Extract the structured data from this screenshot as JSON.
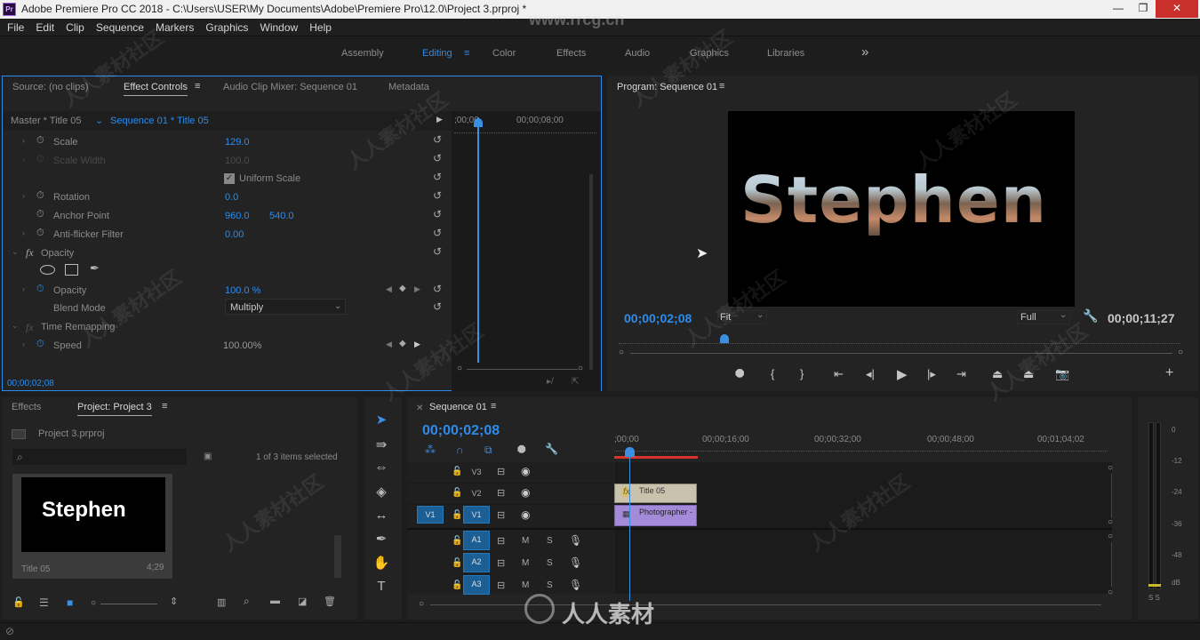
{
  "title_bar": {
    "app_icon": "Pr",
    "title": "Adobe Premiere Pro CC 2018 - C:\\Users\\USER\\My Documents\\Adobe\\Premiere Pro\\12.0\\Project 3.prproj *",
    "minimize": "—",
    "restore": "❐",
    "close": "✕"
  },
  "menu": [
    "File",
    "Edit",
    "Clip",
    "Sequence",
    "Markers",
    "Graphics",
    "Window",
    "Help"
  ],
  "workspaces": {
    "items": [
      "Assembly",
      "Editing",
      "Color",
      "Effects",
      "Audio",
      "Graphics",
      "Libraries"
    ],
    "active": "Editing",
    "more": "»"
  },
  "source_panel": {
    "tabs": [
      "Source: (no clips)",
      "Effect Controls",
      "Audio Clip Mixer: Sequence 01",
      "Metadata"
    ],
    "active_tab": "Effect Controls",
    "master": "Master * Title 05",
    "sequence": "Sequence 01 * Title 05",
    "ruler_start": ";00;00",
    "ruler_end": "00;00;08;00",
    "timecode": "00;00;02;08",
    "properties": [
      {
        "name": "Scale",
        "value": "129.0"
      },
      {
        "name": "Scale Width",
        "value": "100.0"
      },
      {
        "name": "Uniform Scale",
        "value": ""
      },
      {
        "name": "Rotation",
        "value": "0.0"
      },
      {
        "name": "Anchor Point",
        "value": "960.0",
        "value2": "540.0"
      },
      {
        "name": "Anti-flicker Filter",
        "value": "0.00"
      },
      {
        "name": "Opacity",
        "value": ""
      },
      {
        "name": "Opacity",
        "value": "100.0 %"
      },
      {
        "name": "Blend Mode",
        "value": "Multiply"
      },
      {
        "name": "Time Remapping",
        "value": ""
      },
      {
        "name": "Speed",
        "value": "100.00%"
      }
    ],
    "fx": "fx"
  },
  "program": {
    "title": "Program: Sequence 01",
    "title_text": "Stephen",
    "timecode": "00;00;02;08",
    "fit": "Fit",
    "quality": "Full",
    "duration": "00;00;11;27"
  },
  "project": {
    "tabs": [
      "Effects",
      "Project: Project 3"
    ],
    "file": "Project 3.prproj",
    "items_selected": "1 of 3 items selected",
    "clip_name": "Title 05",
    "clip_duration": "4;29",
    "thumb_text": "Stephen"
  },
  "timeline": {
    "tab": "Sequence 01",
    "timecode": "00;00;02;08",
    "ruler": [
      ";00;00",
      "00;00;16;00",
      "00;00;32;00",
      "00;00;48;00",
      "00;01;04;02"
    ],
    "video_tracks": [
      "V3",
      "V2",
      "V1"
    ],
    "audio_tracks": [
      "A1",
      "A2",
      "A3"
    ],
    "source_patch": "V1",
    "clips": [
      {
        "name": "Title 05"
      },
      {
        "name": "Photographer - P"
      }
    ],
    "m": "M",
    "s": "S"
  },
  "meter": {
    "labels": [
      "0",
      "-12",
      "-24",
      "-36",
      "-48",
      "dB"
    ],
    "solo": "S S"
  },
  "watermark": {
    "site": "www.rrcg.cn",
    "brand": "人人素材",
    "chars": "人人素材社区"
  },
  "colors": {
    "accent": "#2d8ceb",
    "title_clip": "#c9c3ad",
    "video_clip": "#a48bd9",
    "playhead": "#3a8fe0",
    "work_area": "#d9342b"
  }
}
